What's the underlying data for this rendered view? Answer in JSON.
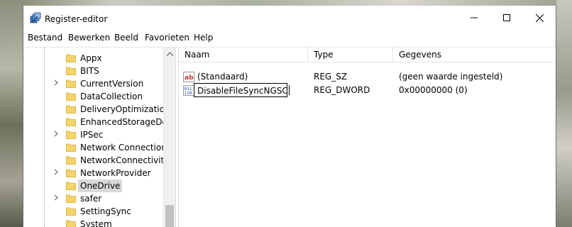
{
  "window": {
    "title": "Register-editor",
    "icon": "regedit-icon"
  },
  "caption_buttons": {
    "minimize": "minimize-icon",
    "maximize": "maximize-icon",
    "close": "close-icon"
  },
  "menu": [
    "Bestand",
    "Bewerken",
    "Beeld",
    "Favorieten",
    "Help"
  ],
  "tree": {
    "items": [
      {
        "label": "Appx",
        "expandable": false,
        "selected": false
      },
      {
        "label": "BITS",
        "expandable": false,
        "selected": false
      },
      {
        "label": "CurrentVersion",
        "expandable": true,
        "selected": false
      },
      {
        "label": "DataCollection",
        "expandable": false,
        "selected": false
      },
      {
        "label": "DeliveryOptimization",
        "expandable": false,
        "selected": false
      },
      {
        "label": "EnhancedStorageDevic",
        "expandable": false,
        "selected": false
      },
      {
        "label": "IPSec",
        "expandable": true,
        "selected": false
      },
      {
        "label": "Network Connections",
        "expandable": false,
        "selected": false
      },
      {
        "label": "NetworkConnectivityS",
        "expandable": false,
        "selected": false
      },
      {
        "label": "NetworkProvider",
        "expandable": true,
        "selected": false
      },
      {
        "label": "OneDrive",
        "expandable": false,
        "selected": true
      },
      {
        "label": "safer",
        "expandable": true,
        "selected": false
      },
      {
        "label": "SettingSync",
        "expandable": false,
        "selected": false
      },
      {
        "label": "System",
        "expandable": false,
        "selected": false
      }
    ]
  },
  "list": {
    "columns": [
      "Naam",
      "Type",
      "Gegevens"
    ],
    "rows": [
      {
        "icon": "string-value-icon",
        "name": "(Standaard)",
        "type": "REG_SZ",
        "data": "(geen waarde ingesteld)",
        "editing": false
      },
      {
        "icon": "binary-value-icon",
        "name": "DisableFileSyncNGSC",
        "type": "REG_DWORD",
        "data": "0x00000000 (0)",
        "editing": true
      }
    ]
  },
  "colors": {
    "selection": "#d9d9d9",
    "folder": "#f5d46b",
    "string_icon": "#c0392b",
    "binary_icon": "#1f4fa0"
  }
}
